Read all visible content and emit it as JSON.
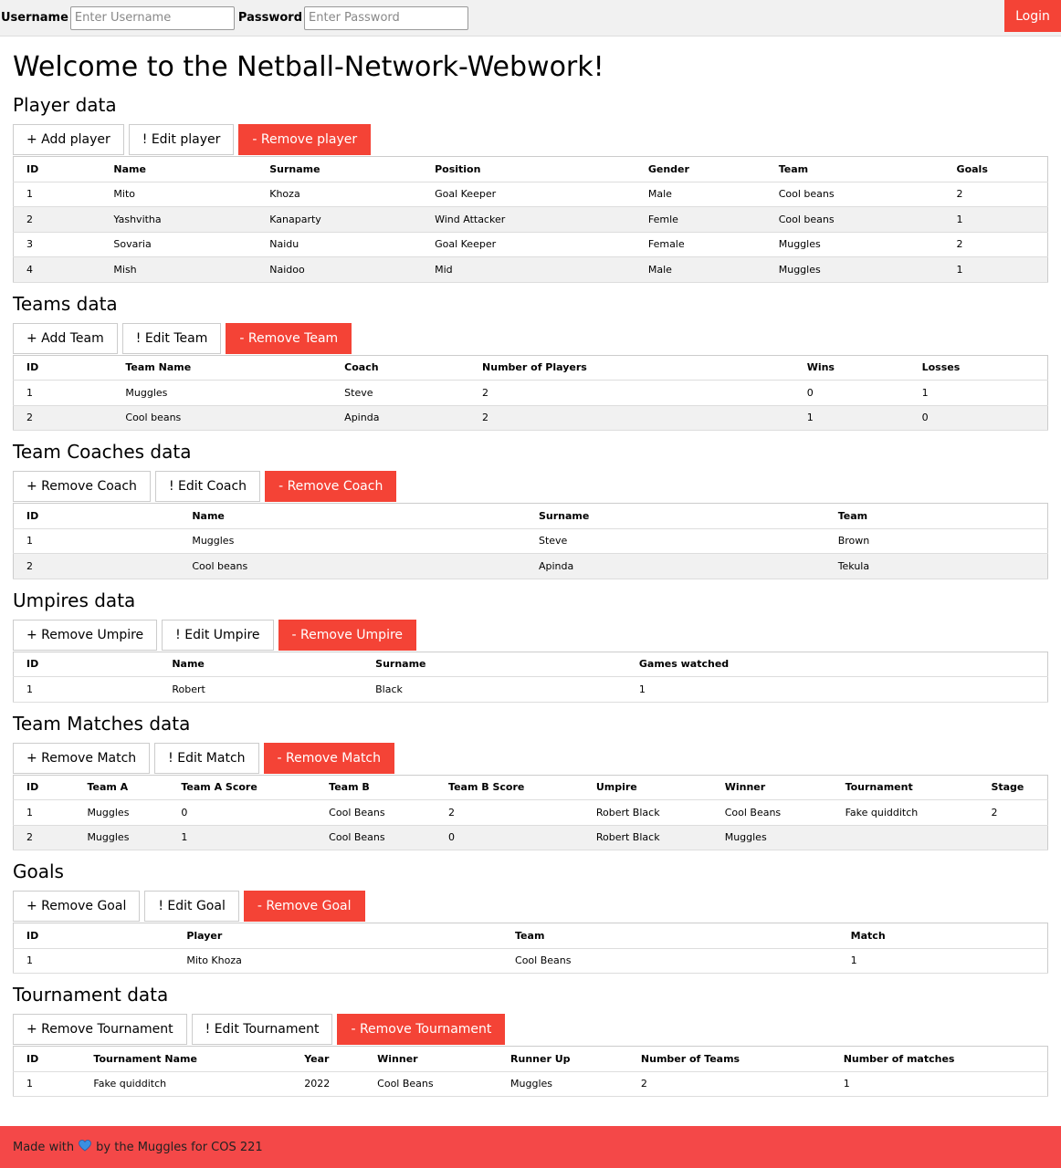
{
  "header": {
    "username_label": "Username",
    "username_placeholder": "Enter Username",
    "password_label": "Password",
    "password_placeholder": "Enter Password",
    "login_label": "Login"
  },
  "title": "Welcome to the Netball-Network-Webwork!",
  "sections": [
    {
      "key": "players",
      "title": "Player data",
      "buttons": [
        "+ Add player",
        "! Edit player",
        "- Remove player"
      ],
      "columns": [
        "ID",
        "Name",
        "Surname",
        "Position",
        "Gender",
        "Team",
        "Goals"
      ],
      "rows": [
        [
          "1",
          "Mito",
          "Khoza",
          "Goal Keeper",
          "Male",
          "Cool beans",
          "2"
        ],
        [
          "2",
          "Yashvitha",
          "Kanaparty",
          "Wind Attacker",
          "Femle",
          "Cool beans",
          "1"
        ],
        [
          "3",
          "Sovaria",
          "Naidu",
          "Goal Keeper",
          "Female",
          "Muggles",
          "2"
        ],
        [
          "4",
          "Mish",
          "Naidoo",
          "Mid",
          "Male",
          "Muggles",
          "1"
        ]
      ]
    },
    {
      "key": "teams",
      "title": "Teams data",
      "buttons": [
        "+ Add Team",
        "! Edit Team",
        "- Remove Team"
      ],
      "columns": [
        "ID",
        "Team Name",
        "Coach",
        "Number of Players",
        "Wins",
        "Losses"
      ],
      "rows": [
        [
          "1",
          "Muggles",
          "Steve",
          "2",
          "0",
          "1"
        ],
        [
          "2",
          "Cool beans",
          "Apinda",
          "2",
          "1",
          "0"
        ]
      ]
    },
    {
      "key": "coaches",
      "title": "Team Coaches data",
      "buttons": [
        "+ Remove Coach",
        "! Edit Coach",
        "- Remove Coach"
      ],
      "columns": [
        "ID",
        "Name",
        "Surname",
        "Team"
      ],
      "rows": [
        [
          "1",
          "Muggles",
          "Steve",
          "Brown"
        ],
        [
          "2",
          "Cool beans",
          "Apinda",
          "Tekula"
        ]
      ]
    },
    {
      "key": "umpires",
      "title": "Umpires data",
      "buttons": [
        "+ Remove Umpire",
        "! Edit Umpire",
        "- Remove Umpire"
      ],
      "columns": [
        "ID",
        "Name",
        "Surname",
        "Games watched"
      ],
      "rows": [
        [
          "1",
          "Robert",
          "Black",
          "1"
        ]
      ]
    },
    {
      "key": "matches",
      "title": "Team Matches data",
      "buttons": [
        "+ Remove Match",
        "! Edit Match",
        "- Remove Match"
      ],
      "columns": [
        "ID",
        "Team A",
        "Team A Score",
        "Team B",
        "Team B Score",
        "Umpire",
        "Winner",
        "Tournament",
        "Stage"
      ],
      "rows": [
        [
          "1",
          "Muggles",
          "0",
          "Cool Beans",
          "2",
          "Robert Black",
          "Cool Beans",
          "Fake quidditch",
          "2"
        ],
        [
          "2",
          "Muggles",
          "1",
          "Cool Beans",
          "0",
          "Robert Black",
          "Muggles",
          "",
          ""
        ]
      ]
    },
    {
      "key": "goals",
      "title": "Goals",
      "buttons": [
        "+ Remove Goal",
        "! Edit Goal",
        "- Remove Goal"
      ],
      "columns": [
        "ID",
        "Player",
        "Team",
        "Match"
      ],
      "rows": [
        [
          "1",
          "Mito Khoza",
          "Cool Beans",
          "1"
        ]
      ]
    },
    {
      "key": "tournaments",
      "title": "Tournament data",
      "buttons": [
        "+ Remove Tournament",
        "! Edit Tournament",
        "- Remove Tournament"
      ],
      "columns": [
        "ID",
        "Tournament Name",
        "Year",
        "Winner",
        "Runner Up",
        "Number of Teams",
        "Number of matches"
      ],
      "rows": [
        [
          "1",
          "Fake quidditch",
          "2022",
          "Cool Beans",
          "Muggles",
          "2",
          "1"
        ]
      ]
    }
  ],
  "footer": {
    "prefix": "Made with",
    "suffix": "by the Muggles for COS 221",
    "heart_icon": "heart-icon"
  },
  "colors": {
    "accent": "#f44336",
    "footer": "#f44848",
    "stripe": "#f1f1f1"
  }
}
